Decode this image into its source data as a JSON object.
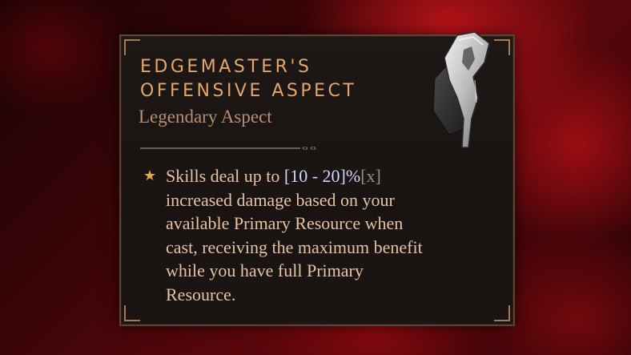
{
  "tooltip": {
    "title_line1": "EDGEMASTER'S",
    "title_line2": "OFFENSIVE ASPECT",
    "subtitle": "Legendary Aspect",
    "icon": "star-icon",
    "description": {
      "line1_prefix": "Skills deal up to ",
      "line1_range": "[10 - 20]%",
      "line1_toggle": "[x]",
      "line2": "increased damage based on your",
      "line3": "available Primary Resource when",
      "line4": "cast, receiving the maximum benefit",
      "line5": "while you have full Primary",
      "line6": "Resource."
    }
  },
  "colors": {
    "title": "#e3a66b",
    "subtitle": "#b88f73",
    "body_text": "#e6c3a3",
    "range_value": "#cfd6ff",
    "star": "#e8a94b",
    "panel_bg": "#1d1715",
    "background_red": "#8a0a10"
  }
}
